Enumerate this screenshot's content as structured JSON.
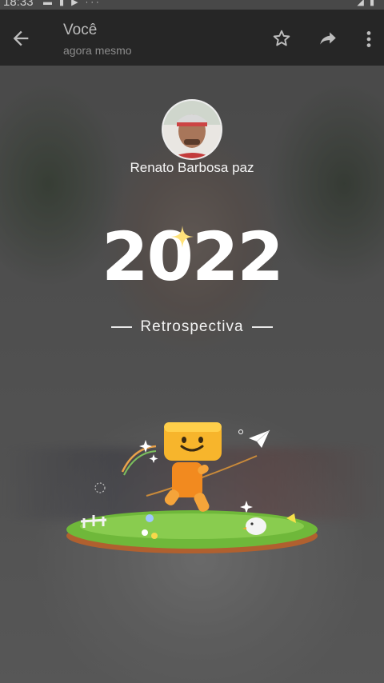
{
  "status_bar": {
    "time": "18:33"
  },
  "header": {
    "title": "Você",
    "subtitle": "agora mesmo",
    "icons": [
      "back-arrow-icon",
      "star-icon",
      "share-icon",
      "more-vert-icon"
    ]
  },
  "story": {
    "author_name": "Renato Barbosa paz",
    "year": "2022",
    "label": "Retrospectiva"
  },
  "colors": {
    "appbar": "#1c1c1c",
    "mascot": "#f7b52c",
    "grass": "#6fb83a"
  }
}
